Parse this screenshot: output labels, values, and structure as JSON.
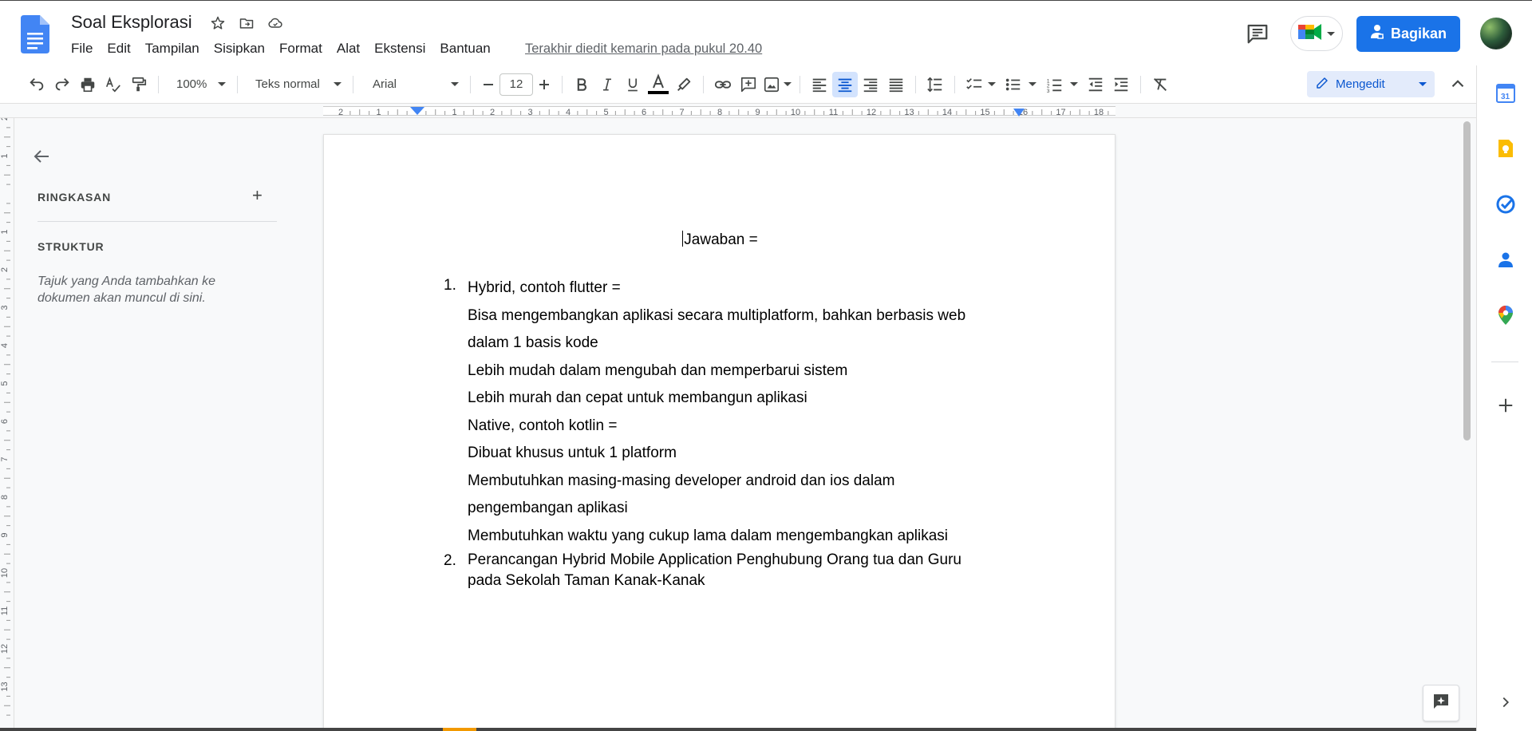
{
  "header": {
    "title": "Soal Eksplorasi",
    "menu": [
      "File",
      "Edit",
      "Tampilan",
      "Sisipkan",
      "Format",
      "Alat",
      "Ekstensi",
      "Bantuan"
    ],
    "last_edit": "Terakhir diedit kemarin pada pukul 20.40",
    "share_label": "Bagikan"
  },
  "toolbar": {
    "zoom": "100%",
    "style": "Teks normal",
    "font": "Arial",
    "font_size": "12",
    "mode": "Mengedit"
  },
  "outline": {
    "summary_label": "RINGKASAN",
    "structure_label": "STRUKTUR",
    "hint": "Tajuk yang Anda tambahkan ke dokumen akan muncul di sini."
  },
  "ruler": {
    "h_labels": [
      "2",
      "1",
      "1",
      "2",
      "3",
      "4",
      "5",
      "6",
      "7",
      "8",
      "9",
      "10",
      "11",
      "12",
      "13",
      "14",
      "15",
      "16",
      "17",
      "18"
    ],
    "v_labels": [
      "2",
      "1",
      "1",
      "2",
      "3",
      "4",
      "5",
      "6",
      "7",
      "8",
      "9",
      "10",
      "11",
      "12",
      "13"
    ]
  },
  "document": {
    "heading": "Jawaban =",
    "items": [
      {
        "number": "1.",
        "lines": [
          "Hybrid, contoh flutter =",
          "Bisa mengembangkan aplikasi secara multiplatform, bahkan berbasis web",
          "dalam 1 basis kode",
          "Lebih mudah dalam mengubah dan memperbarui sistem",
          "Lebih murah dan cepat untuk membangun aplikasi",
          "Native, contoh kotlin =",
          "Dibuat khusus untuk 1 platform",
          "Membutuhkan masing-masing developer android dan ios dalam",
          "pengembangan aplikasi",
          "Membutuhkan waktu yang cukup lama dalam mengembangkan aplikasi"
        ]
      },
      {
        "number": "2.",
        "lines": [
          "Perancangan Hybrid Mobile Application Penghubung Orang tua dan Guru",
          "pada Sekolah Taman Kanak-Kanak"
        ]
      }
    ]
  },
  "colors": {
    "accent": "#1a73e8",
    "doc_icon": "#4285f4"
  }
}
